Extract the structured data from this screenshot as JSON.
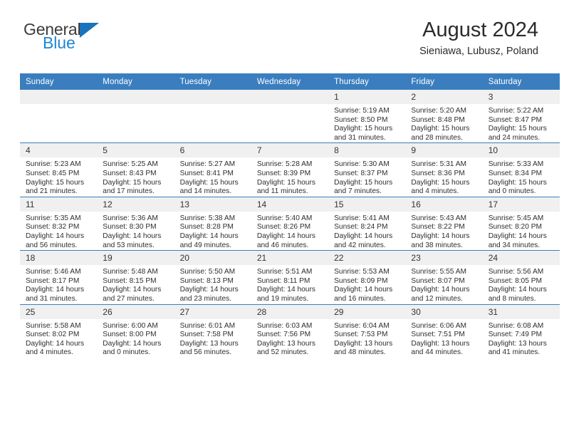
{
  "brand": {
    "name_part1": "General",
    "name_part2": "Blue",
    "triangle_color": "#1b74bb",
    "blue_text_color": "#1b86d6"
  },
  "header": {
    "title": "August 2024",
    "subtitle": "Sieniawa, Lubusz, Poland"
  },
  "theme": {
    "header_bg": "#3a7ebf",
    "daynum_bg": "#f0f0f0",
    "row_border": "#3a7ebf",
    "page_bg": "#ffffff"
  },
  "weekdays": [
    "Sunday",
    "Monday",
    "Tuesday",
    "Wednesday",
    "Thursday",
    "Friday",
    "Saturday"
  ],
  "labels": {
    "sunrise_prefix": "Sunrise:",
    "sunset_prefix": "Sunset:",
    "daylight_prefix": "Daylight:"
  },
  "weeks": [
    [
      {
        "day": "",
        "empty": true
      },
      {
        "day": "",
        "empty": true
      },
      {
        "day": "",
        "empty": true
      },
      {
        "day": "",
        "empty": true
      },
      {
        "day": "1",
        "sunrise": "Sunrise: 5:19 AM",
        "sunset": "Sunset: 8:50 PM",
        "daylight1": "Daylight: 15 hours",
        "daylight2": "and 31 minutes."
      },
      {
        "day": "2",
        "sunrise": "Sunrise: 5:20 AM",
        "sunset": "Sunset: 8:48 PM",
        "daylight1": "Daylight: 15 hours",
        "daylight2": "and 28 minutes."
      },
      {
        "day": "3",
        "sunrise": "Sunrise: 5:22 AM",
        "sunset": "Sunset: 8:47 PM",
        "daylight1": "Daylight: 15 hours",
        "daylight2": "and 24 minutes."
      }
    ],
    [
      {
        "day": "4",
        "sunrise": "Sunrise: 5:23 AM",
        "sunset": "Sunset: 8:45 PM",
        "daylight1": "Daylight: 15 hours",
        "daylight2": "and 21 minutes."
      },
      {
        "day": "5",
        "sunrise": "Sunrise: 5:25 AM",
        "sunset": "Sunset: 8:43 PM",
        "daylight1": "Daylight: 15 hours",
        "daylight2": "and 17 minutes."
      },
      {
        "day": "6",
        "sunrise": "Sunrise: 5:27 AM",
        "sunset": "Sunset: 8:41 PM",
        "daylight1": "Daylight: 15 hours",
        "daylight2": "and 14 minutes."
      },
      {
        "day": "7",
        "sunrise": "Sunrise: 5:28 AM",
        "sunset": "Sunset: 8:39 PM",
        "daylight1": "Daylight: 15 hours",
        "daylight2": "and 11 minutes."
      },
      {
        "day": "8",
        "sunrise": "Sunrise: 5:30 AM",
        "sunset": "Sunset: 8:37 PM",
        "daylight1": "Daylight: 15 hours",
        "daylight2": "and 7 minutes."
      },
      {
        "day": "9",
        "sunrise": "Sunrise: 5:31 AM",
        "sunset": "Sunset: 8:36 PM",
        "daylight1": "Daylight: 15 hours",
        "daylight2": "and 4 minutes."
      },
      {
        "day": "10",
        "sunrise": "Sunrise: 5:33 AM",
        "sunset": "Sunset: 8:34 PM",
        "daylight1": "Daylight: 15 hours",
        "daylight2": "and 0 minutes."
      }
    ],
    [
      {
        "day": "11",
        "sunrise": "Sunrise: 5:35 AM",
        "sunset": "Sunset: 8:32 PM",
        "daylight1": "Daylight: 14 hours",
        "daylight2": "and 56 minutes."
      },
      {
        "day": "12",
        "sunrise": "Sunrise: 5:36 AM",
        "sunset": "Sunset: 8:30 PM",
        "daylight1": "Daylight: 14 hours",
        "daylight2": "and 53 minutes."
      },
      {
        "day": "13",
        "sunrise": "Sunrise: 5:38 AM",
        "sunset": "Sunset: 8:28 PM",
        "daylight1": "Daylight: 14 hours",
        "daylight2": "and 49 minutes."
      },
      {
        "day": "14",
        "sunrise": "Sunrise: 5:40 AM",
        "sunset": "Sunset: 8:26 PM",
        "daylight1": "Daylight: 14 hours",
        "daylight2": "and 46 minutes."
      },
      {
        "day": "15",
        "sunrise": "Sunrise: 5:41 AM",
        "sunset": "Sunset: 8:24 PM",
        "daylight1": "Daylight: 14 hours",
        "daylight2": "and 42 minutes."
      },
      {
        "day": "16",
        "sunrise": "Sunrise: 5:43 AM",
        "sunset": "Sunset: 8:22 PM",
        "daylight1": "Daylight: 14 hours",
        "daylight2": "and 38 minutes."
      },
      {
        "day": "17",
        "sunrise": "Sunrise: 5:45 AM",
        "sunset": "Sunset: 8:20 PM",
        "daylight1": "Daylight: 14 hours",
        "daylight2": "and 34 minutes."
      }
    ],
    [
      {
        "day": "18",
        "sunrise": "Sunrise: 5:46 AM",
        "sunset": "Sunset: 8:17 PM",
        "daylight1": "Daylight: 14 hours",
        "daylight2": "and 31 minutes."
      },
      {
        "day": "19",
        "sunrise": "Sunrise: 5:48 AM",
        "sunset": "Sunset: 8:15 PM",
        "daylight1": "Daylight: 14 hours",
        "daylight2": "and 27 minutes."
      },
      {
        "day": "20",
        "sunrise": "Sunrise: 5:50 AM",
        "sunset": "Sunset: 8:13 PM",
        "daylight1": "Daylight: 14 hours",
        "daylight2": "and 23 minutes."
      },
      {
        "day": "21",
        "sunrise": "Sunrise: 5:51 AM",
        "sunset": "Sunset: 8:11 PM",
        "daylight1": "Daylight: 14 hours",
        "daylight2": "and 19 minutes."
      },
      {
        "day": "22",
        "sunrise": "Sunrise: 5:53 AM",
        "sunset": "Sunset: 8:09 PM",
        "daylight1": "Daylight: 14 hours",
        "daylight2": "and 16 minutes."
      },
      {
        "day": "23",
        "sunrise": "Sunrise: 5:55 AM",
        "sunset": "Sunset: 8:07 PM",
        "daylight1": "Daylight: 14 hours",
        "daylight2": "and 12 minutes."
      },
      {
        "day": "24",
        "sunrise": "Sunrise: 5:56 AM",
        "sunset": "Sunset: 8:05 PM",
        "daylight1": "Daylight: 14 hours",
        "daylight2": "and 8 minutes."
      }
    ],
    [
      {
        "day": "25",
        "sunrise": "Sunrise: 5:58 AM",
        "sunset": "Sunset: 8:02 PM",
        "daylight1": "Daylight: 14 hours",
        "daylight2": "and 4 minutes."
      },
      {
        "day": "26",
        "sunrise": "Sunrise: 6:00 AM",
        "sunset": "Sunset: 8:00 PM",
        "daylight1": "Daylight: 14 hours",
        "daylight2": "and 0 minutes."
      },
      {
        "day": "27",
        "sunrise": "Sunrise: 6:01 AM",
        "sunset": "Sunset: 7:58 PM",
        "daylight1": "Daylight: 13 hours",
        "daylight2": "and 56 minutes."
      },
      {
        "day": "28",
        "sunrise": "Sunrise: 6:03 AM",
        "sunset": "Sunset: 7:56 PM",
        "daylight1": "Daylight: 13 hours",
        "daylight2": "and 52 minutes."
      },
      {
        "day": "29",
        "sunrise": "Sunrise: 6:04 AM",
        "sunset": "Sunset: 7:53 PM",
        "daylight1": "Daylight: 13 hours",
        "daylight2": "and 48 minutes."
      },
      {
        "day": "30",
        "sunrise": "Sunrise: 6:06 AM",
        "sunset": "Sunset: 7:51 PM",
        "daylight1": "Daylight: 13 hours",
        "daylight2": "and 44 minutes."
      },
      {
        "day": "31",
        "sunrise": "Sunrise: 6:08 AM",
        "sunset": "Sunset: 7:49 PM",
        "daylight1": "Daylight: 13 hours",
        "daylight2": "and 41 minutes."
      }
    ]
  ]
}
